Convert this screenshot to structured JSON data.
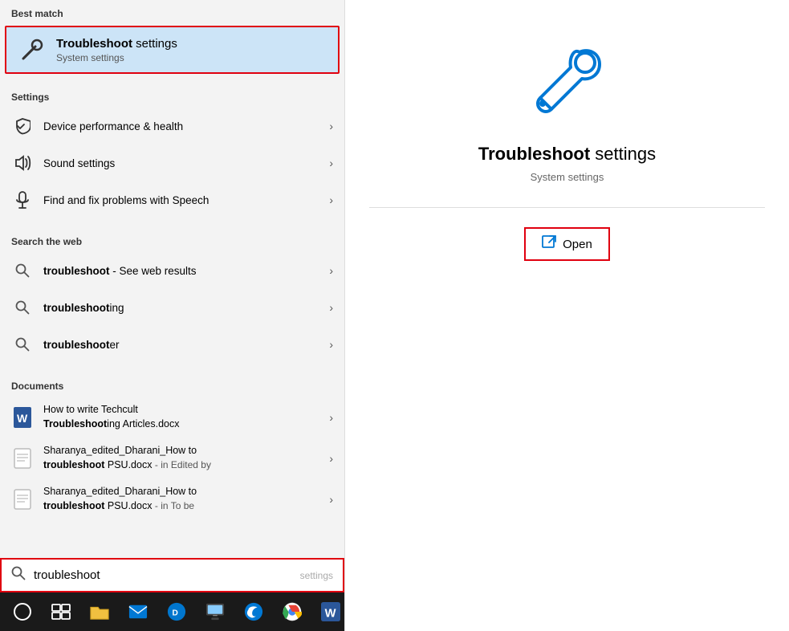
{
  "colors": {
    "accent": "#0078d4",
    "redBorder": "#e0000f",
    "bestMatchBg": "#cce4f7",
    "taskbarBg": "#1a1a1a"
  },
  "leftPanel": {
    "bestMatch": {
      "sectionLabel": "Best match",
      "title_bold": "Troubleshoot",
      "title_rest": " settings",
      "subtitle": "System settings"
    },
    "settings": {
      "sectionLabel": "Settings",
      "items": [
        {
          "label": "Device performance & health"
        },
        {
          "label": "Sound settings"
        },
        {
          "label": "Find and fix problems with Speech"
        }
      ]
    },
    "searchWeb": {
      "sectionLabel": "Search the web",
      "items": [
        {
          "bold": "troubleshoot",
          "rest": " - See web results"
        },
        {
          "bold": "troubleshoot",
          "rest": "ing"
        },
        {
          "bold": "troubleshoot",
          "rest": "er"
        }
      ]
    },
    "documents": {
      "sectionLabel": "Documents",
      "items": [
        {
          "line1": "How to write Techcult",
          "line2_pre": "Troubleshoot",
          "line2_rest": "ing Articles.docx",
          "hasWordIcon": true
        },
        {
          "line1": "Sharanya_edited_Dharani_How to",
          "line2_pre": "troubleshoot",
          "line2_rest": " PSU.docx - in Edited by",
          "hasWordIcon": false
        },
        {
          "line1": "Sharanya_edited_Dharani_How to",
          "line2_pre": "troubleshoot",
          "line2_rest": " PSU.docx - in To be",
          "hasWordIcon": false
        }
      ]
    },
    "searchBar": {
      "typed": "troubleshoot",
      "placeholder": " settings"
    }
  },
  "rightPanel": {
    "title_bold": "Troubleshoot",
    "title_rest": " settings",
    "subtitle": "System settings",
    "openButton": "Open"
  },
  "taskbar": {
    "items": [
      {
        "name": "search-icon",
        "label": "Search"
      },
      {
        "name": "task-view-icon",
        "label": "Task View"
      },
      {
        "name": "file-explorer-icon",
        "label": "File Explorer"
      },
      {
        "name": "mail-icon",
        "label": "Mail"
      },
      {
        "name": "dell-icon",
        "label": "Dell"
      },
      {
        "name": "remote-icon",
        "label": "Remote Desktop"
      },
      {
        "name": "edge-icon",
        "label": "Edge"
      },
      {
        "name": "chrome-icon",
        "label": "Chrome"
      },
      {
        "name": "word-icon",
        "label": "Word"
      }
    ]
  }
}
